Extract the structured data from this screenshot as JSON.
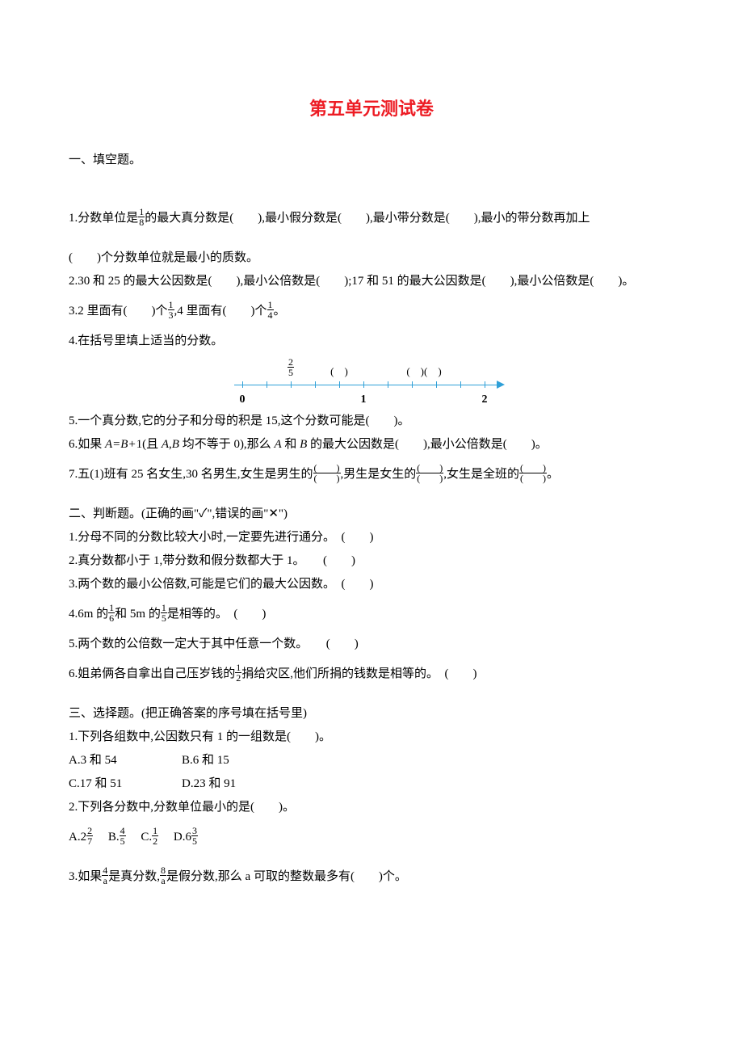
{
  "title": "第五单元测试卷",
  "sec1": {
    "heading": "一、填空题。",
    "q1_a": "1.分数单位是",
    "q1_frac_n": "1",
    "q1_frac_d": "8",
    "q1_b": "的最大真分数是(　　),最小假分数是(　　),最小带分数是(　　),最小的带分数再加上",
    "q1_c": "(　　)个分数单位就是最小的质数。",
    "q2": "2.30 和 25 的最大公因数是(　　),最小公倍数是(　　);17 和 51 的最大公因数是(　　),最小公倍数是(　　)。",
    "q3_a": "3.2 里面有(　　)个",
    "q3_f1n": "1",
    "q3_f1d": "3",
    "q3_b": ",4 里面有(　　)个",
    "q3_f2n": "1",
    "q3_f2d": "4",
    "q3_c": "。",
    "q4": "4.在括号里填上适当的分数。",
    "nl": {
      "frac_n": "2",
      "frac_d": "5",
      "paren1": "(　)",
      "paren2": "(　)(　)",
      "lbl0": "0",
      "lbl1": "1",
      "lbl2": "2"
    },
    "q5": "5.一个真分数,它的分子和分母的积是 15,这个分数可能是(　　)。",
    "q6_a": "6.如果 ",
    "q6_i1": "A=B+",
    "q6_b": "1(且 ",
    "q6_i2": "A",
    "q6_c": ",",
    "q6_i3": "B",
    "q6_d": " 均不等于 0),那么 ",
    "q6_i4": "A",
    "q6_e": " 和 ",
    "q6_i5": "B",
    "q6_f": " 的最大公因数是(　　),最小公倍数是(　　)。",
    "q7_a": "7.五(1)班有 25 名女生,30 名男生,女生是男生的",
    "q7_pn": "(　　)",
    "q7_pd": "(　　)",
    "q7_b": ",男生是女生的",
    "q7_c": ",女生是全班的",
    "q7_d": "。"
  },
  "sec2": {
    "heading": "二、判断题。(正确的画\"✓\",错误的画\"✕\")",
    "q1": "1.分母不同的分数比较大小时,一定要先进行通分。　(　　)",
    "q2": "2.真分数都小于 1,带分数和假分数都大于 1。　　(　　)",
    "q3": "3.两个数的最小公倍数,可能是它们的最大公因数。　(　　)",
    "q4_a": "4.6m 的",
    "q4_f1n": "1",
    "q4_f1d": "6",
    "q4_b": "和 5m 的",
    "q4_f2n": "1",
    "q4_f2d": "5",
    "q4_c": "是相等的。　(　　)",
    "q5": "5.两个数的公倍数一定大于其中任意一个数。　　(　　)",
    "q6_a": "6.姐弟俩各自拿出自己压岁钱的",
    "q6_fn": "1",
    "q6_fd": "2",
    "q6_b": "捐给灾区,他们所捐的钱数是相等的。　(　　)"
  },
  "sec3": {
    "heading": "三、选择题。(把正确答案的序号填在括号里)",
    "q1": "1.下列各组数中,公因数只有 1 的一组数是(　　)。",
    "q1a": "A.3 和 54",
    "q1b": "B.6 和 15",
    "q1c": "C.17 和 51",
    "q1d": "D.23 和 91",
    "q2": "2.下列各分数中,分数单位最小的是(　　)。",
    "q2a_pre": "A.2",
    "q2a_n": "2",
    "q2a_d": "7",
    "q2b_pre": "B.",
    "q2b_n": "4",
    "q2b_d": "5",
    "q2c_pre": "C.",
    "q2c_n": "1",
    "q2c_d": "2",
    "q2d_pre": "D.6",
    "q2d_n": "3",
    "q2d_d": "5",
    "q3_a": "3.如果",
    "q3_f1n": "4",
    "q3_f1d": "a",
    "q3_b": "是真分数,",
    "q3_f2n": "8",
    "q3_f2d": "a",
    "q3_c": "是假分数,那么 a 可取的整数最多有(　　)个。"
  }
}
